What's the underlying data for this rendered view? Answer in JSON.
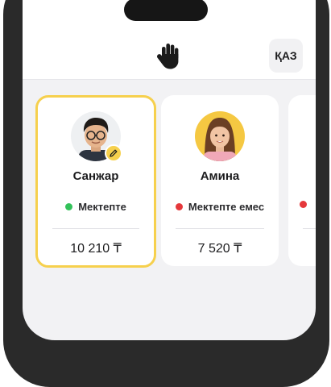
{
  "header": {
    "icon": "waving-hand-icon",
    "lang_label": "ҚАЗ"
  },
  "children": [
    {
      "name": "Санжар",
      "status": "Мектепте",
      "status_color": "#33c25a",
      "balance": "10 210 ₸",
      "selected": true,
      "avatar": "boy-with-glasses"
    },
    {
      "name": "Амина",
      "status": "Мектепте емес",
      "status_color": "#e5383b",
      "balance": "7 520 ₸",
      "selected": false,
      "avatar": "girl-smiling"
    },
    {
      "name": "",
      "status": "",
      "status_color": "#e5383b",
      "balance": "",
      "selected": false,
      "avatar": ""
    }
  ],
  "colors": {
    "accent_yellow": "#f6d04d",
    "frame": "#2a2a2a",
    "screen_bg": "#f2f2f4"
  }
}
